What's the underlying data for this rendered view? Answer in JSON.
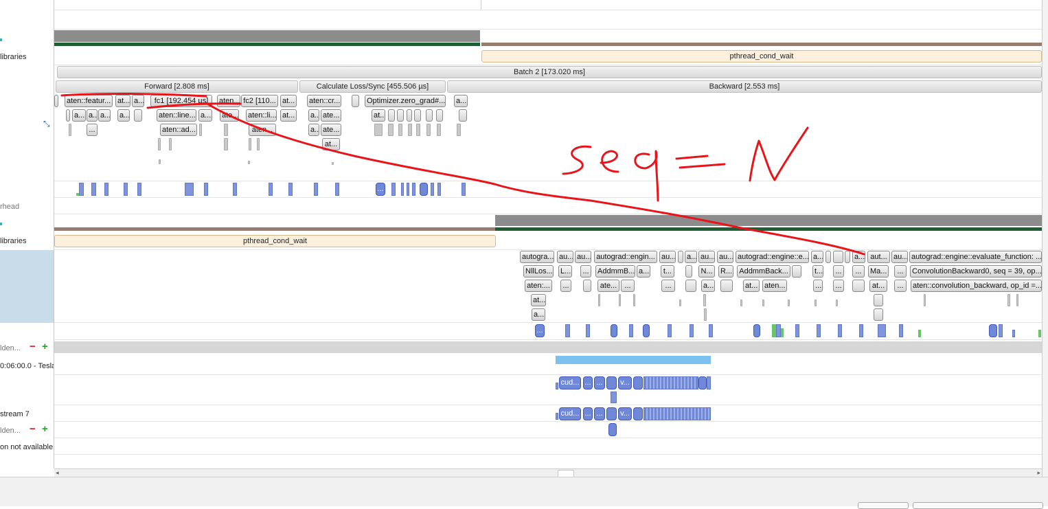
{
  "left_labels": {
    "libraries_1": "libraries",
    "overhead": "rhead",
    "libraries_2": "libraries",
    "hidden_1": "lden...",
    "gpu": "0:06:00.0 - Tesla",
    "stream": "stream 7",
    "hidden_2": "lden...",
    "not_available": "on not available"
  },
  "ranges": {
    "pthread_top": "pthread_cond_wait",
    "pthread_bottom": "pthread_cond_wait",
    "batch": "Batch 2 [173.020 ms]",
    "forward": "Forward [2.808 ms]",
    "loss": "Calculate Loss/Sync [455.506 µs]",
    "backward": "Backward [2.553 ms]"
  },
  "cpu_ranges": {
    "r1": [
      "aten::featur...",
      "at...",
      "a...",
      "fc1 [192.454 µs]",
      "aten...",
      "fc2 [110...",
      "at...",
      "aten::cr...",
      "Optimizer.zero_grad#...",
      "a..."
    ],
    "r2": [
      "a...",
      "a...",
      "a...",
      "a...",
      "aten::line...",
      "a...",
      "ate...",
      "aten::li...",
      "at...",
      "a...",
      "ate...",
      "at..."
    ],
    "r3": [
      "...",
      "aten::ad...",
      "aten...",
      "a...",
      "ate..."
    ],
    "r4": [
      "at..."
    ]
  },
  "thread_ranges": {
    "r1": [
      "autogra...",
      "au...",
      "au...",
      "autograd::engin...",
      "au...",
      "a...",
      "au...",
      "au...",
      "autograd::engine::e...",
      "a...",
      "a...",
      "aut...",
      "au...",
      "autograd::engine::evaluate_function: ..."
    ],
    "r2": [
      "NllLos...",
      "L...",
      "...",
      "AddmmB...",
      "a...",
      "t...",
      "N...",
      "R...",
      "AddmmBack...",
      "t...",
      "...",
      "...",
      "Ma...",
      "...",
      "ConvolutionBackward0, seq = 39, op..."
    ],
    "r3": [
      "aten:...",
      "...",
      "...",
      "ate...",
      "...",
      "...",
      "a...",
      "at...",
      "aten...",
      "...",
      "...",
      "at...",
      "...",
      "aten::convolution_backward, op_id =..."
    ],
    "r4": [
      "at..."
    ],
    "r5": [
      "a..."
    ]
  },
  "cuda_labels": {
    "row1": [
      "cud...",
      "...",
      "...",
      "v..."
    ],
    "row2": [
      "cud...",
      "...",
      "...",
      "v..."
    ],
    "cpu_marker": "...",
    "thread_marker": "..."
  },
  "annotation": {
    "text": "seq = N",
    "color": "#e8141a"
  },
  "colors": {
    "range_gray": "#d8d8d8",
    "pthread": "#fdf1de",
    "cuda_blue": "#7e95de",
    "activity_green": "#1f5e34",
    "activity_brown": "#977d6f",
    "selection": "#c9dcea"
  }
}
